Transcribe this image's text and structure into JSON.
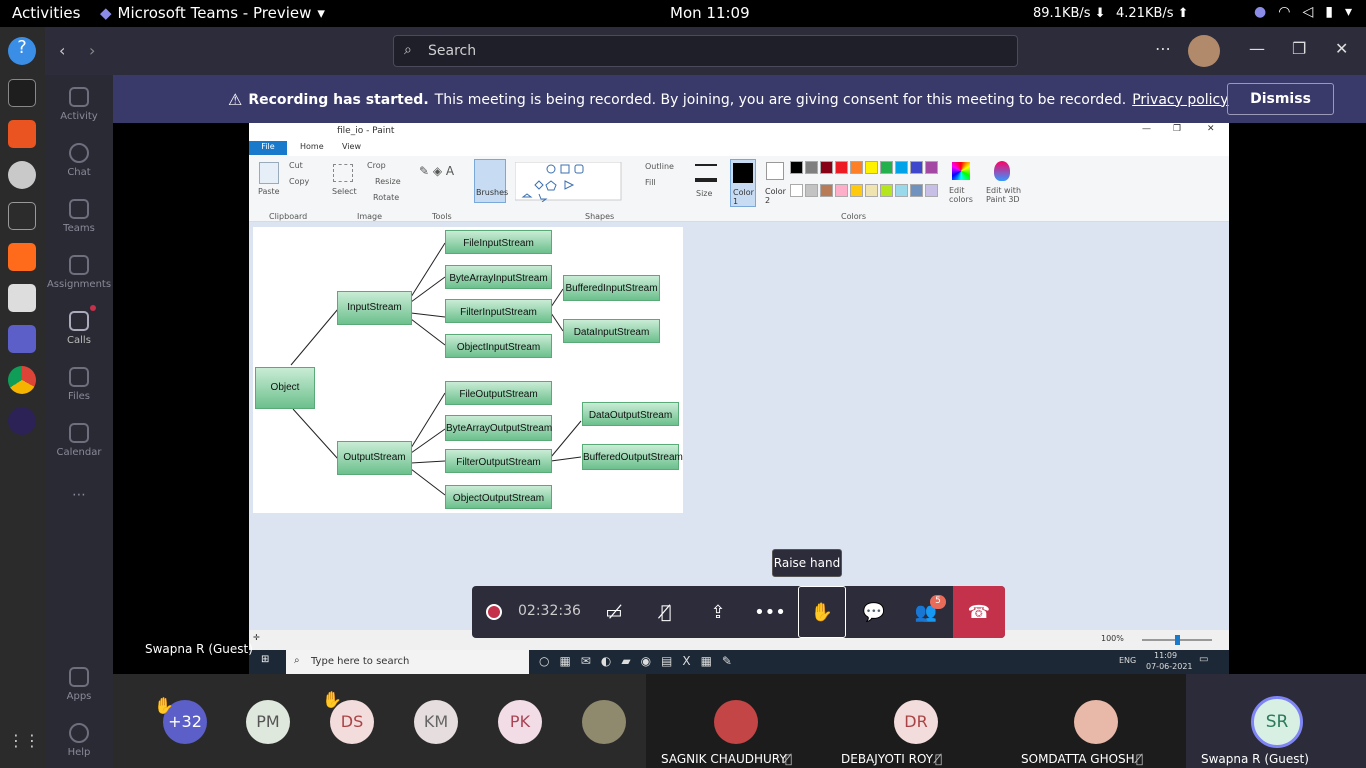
{
  "topbar": {
    "activities": "Activities",
    "app_title": "Microsoft Teams - Preview",
    "clock": "Mon 11:09",
    "down": "89.1KB/s ⬇",
    "up": "4.21KB/s ⬆"
  },
  "search": {
    "placeholder": "Search"
  },
  "rail": {
    "items": [
      "Activity",
      "Chat",
      "Teams",
      "Assignments",
      "Calls",
      "Files",
      "Calendar",
      "Apps",
      "Help"
    ]
  },
  "banner": {
    "bold": "Recording has started.",
    "text": "This meeting is being recorded. By joining, you are giving consent for this meeting to be recorded.",
    "link": "Privacy policy",
    "dismiss": "Dismiss"
  },
  "paint": {
    "title": "file_io - Paint",
    "tabs": [
      "File",
      "Home",
      "View"
    ],
    "groups": {
      "clipboard": "Clipboard",
      "image": "Image",
      "tools": "Tools",
      "shapes": "Shapes",
      "colors": "Colors"
    },
    "buttons": {
      "paste": "Paste",
      "cut": "Cut",
      "copy": "Copy",
      "select": "Select",
      "crop": "Crop",
      "resize": "Resize",
      "rotate": "Rotate",
      "brushes": "Brushes",
      "outline": "Outline",
      "fill": "Fill",
      "size": "Size",
      "color1": "Color 1",
      "color2": "Color 2",
      "edit_colors": "Edit colors",
      "edit3d": "Edit with Paint 3D"
    },
    "palette": [
      "#000000",
      "#7f7f7f",
      "#880015",
      "#ed1c24",
      "#ff7f27",
      "#fff200",
      "#22b14c",
      "#00a2e8",
      "#3f48cc",
      "#a349a4",
      "#ffffff",
      "#c3c3c3",
      "#b97a57",
      "#ffaec9",
      "#ffc90e",
      "#efe4b0",
      "#b5e61d",
      "#99d9ea",
      "#7092be",
      "#c8bfe7"
    ],
    "zoom": "100%"
  },
  "diagram": {
    "object": "Object",
    "input": "InputStream",
    "output": "OutputStream",
    "in_children": [
      "FileInputStream",
      "ByteArrayInputStream",
      "FilterInputStream",
      "ObjectInputStream"
    ],
    "filter_in": [
      "BufferedInputStream",
      "DataInputStream"
    ],
    "out_children": [
      "FileOutputStream",
      "ByteArrayOutputStream",
      "FilterOutputStream",
      "ObjectOutputStream"
    ],
    "filter_out": [
      "DataOutputStream",
      "BufferedOutputStream"
    ]
  },
  "win_taskbar": {
    "search": "Type here to search",
    "lang": "ENG",
    "time": "11:09",
    "date": "07-06-2021"
  },
  "call": {
    "timer": "02:32:36",
    "tooltip": "Raise hand",
    "people_badge": "5",
    "presenter": "Swapna R (Guest)"
  },
  "participants": [
    {
      "initials": "+32",
      "color": "#5b5fc7",
      "fg": "#fff"
    },
    {
      "initials": "PM",
      "color": "#dfe8dc",
      "fg": "#555"
    },
    {
      "initials": "DS",
      "color": "#f3dcdc",
      "fg": "#a44"
    },
    {
      "initials": "KM",
      "color": "#e6dede",
      "fg": "#666"
    },
    {
      "initials": "PK",
      "color": "#f2dde6",
      "fg": "#a45"
    }
  ],
  "video_tiles": [
    {
      "name": "SAGNIK CHAUDHURY"
    },
    {
      "name": "DEBAJYOTI ROY",
      "initials": "DR"
    },
    {
      "name": "SOMDATTA GHOSH"
    },
    {
      "name": "Swapna R (Guest)",
      "initials": "SR"
    }
  ]
}
